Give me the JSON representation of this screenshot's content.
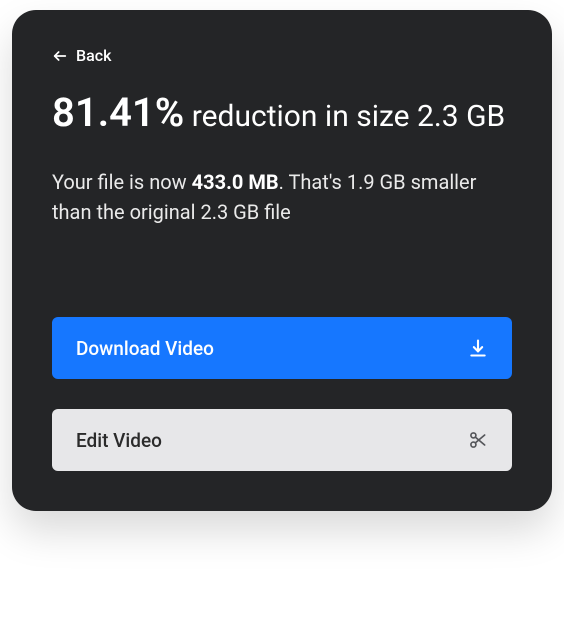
{
  "back": {
    "label": "Back"
  },
  "headline": {
    "percent": "81.41%",
    "rest": " reduction in size 2.3 GB"
  },
  "description": {
    "part1": "Your file is now ",
    "new_size": "433.0 MB",
    "part2": ". That's 1.9 GB smaller than the original 2.3 GB file"
  },
  "buttons": {
    "download": "Download Video",
    "edit": "Edit Video"
  }
}
